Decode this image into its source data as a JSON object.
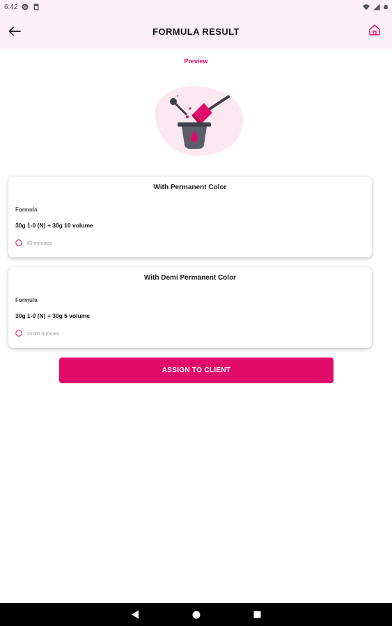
{
  "status_bar": {
    "time": "6:42",
    "icons": [
      "g-icon",
      "sim-icon",
      "wifi-icon",
      "signal-icon",
      "battery-icon"
    ]
  },
  "app_bar": {
    "title": "FORMULA RESULT",
    "back_icon": "back-arrow-icon",
    "home_icon": "home-icon"
  },
  "preview": {
    "label": "Preview",
    "illustration": "hair-color-bowl-brush-illustration"
  },
  "cards": [
    {
      "title": "With Permanent Color",
      "formula_label": "Formula",
      "formula": "30g 1-0 (N) + 30g 10 volume",
      "time": "45 minutes"
    },
    {
      "title": "With Demi Permanent Color",
      "formula_label": "Formula",
      "formula": "30g 1-0 (N) + 30g 5 volume",
      "time": "10-20 minutes"
    }
  ],
  "assign_button": {
    "label": "ASSIGN TO CLIENT"
  },
  "nav_bar": {
    "icons": [
      "nav-back-icon",
      "nav-home-icon",
      "nav-recents-icon"
    ]
  },
  "colors": {
    "accent": "#e20a6a",
    "header_bg": "#fdf0f6",
    "blob": "#fce8f1",
    "bowl": "#5b5d6b"
  }
}
